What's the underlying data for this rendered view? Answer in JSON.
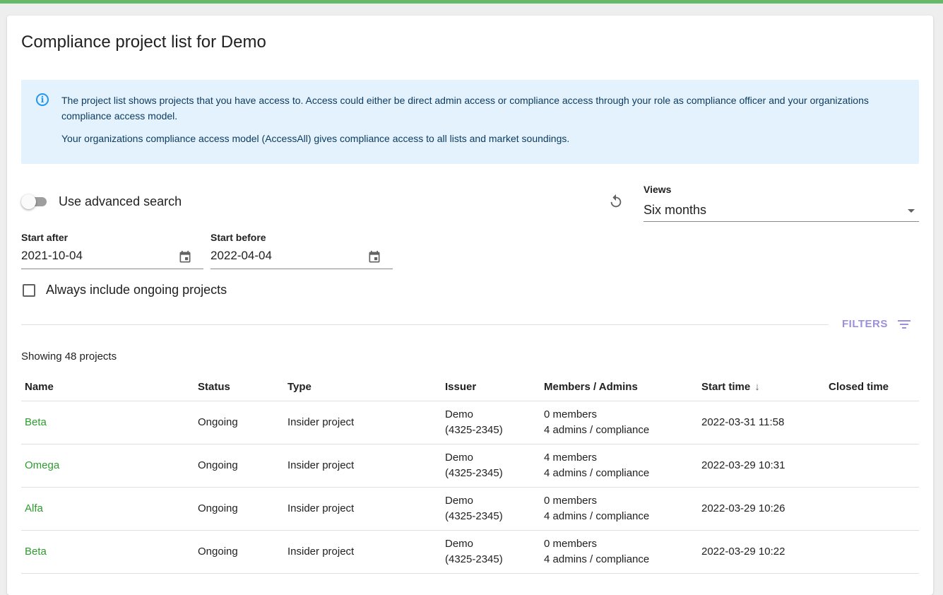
{
  "page": {
    "title": "Compliance project list for Demo"
  },
  "info": {
    "line1": "The project list shows projects that you have access to. Access could either be direct admin access or compliance access through your role as compliance officer and your organizations compliance access model.",
    "line2": "Your organizations compliance access model (AccessAll) gives compliance access to all lists and market soundings."
  },
  "search": {
    "advanced_label": "Use advanced search",
    "advanced_enabled": false
  },
  "views": {
    "label": "Views",
    "selected": "Six months"
  },
  "dates": {
    "start_after_label": "Start after",
    "start_after_value": "2021-10-04",
    "start_before_label": "Start before",
    "start_before_value": "2022-04-04"
  },
  "ongoing": {
    "label": "Always include ongoing projects",
    "checked": false
  },
  "filters": {
    "label": "FILTERS"
  },
  "list": {
    "count_text": "Showing 48 projects",
    "columns": [
      "Name",
      "Status",
      "Type",
      "Issuer",
      "Members / Admins",
      "Start time",
      "Closed time"
    ],
    "sort_arrow": "↓",
    "rows": [
      {
        "name": "Beta",
        "status": "Ongoing",
        "type": "Insider project",
        "issuer_name": "Demo",
        "issuer_id": "(4325-2345)",
        "members": "0 members",
        "admins": "4 admins / compliance",
        "start": "2022-03-31 11:58",
        "closed": ""
      },
      {
        "name": "Omega",
        "status": "Ongoing",
        "type": "Insider project",
        "issuer_name": "Demo",
        "issuer_id": "(4325-2345)",
        "members": "4 members",
        "admins": "4 admins / compliance",
        "start": "2022-03-29 10:31",
        "closed": ""
      },
      {
        "name": "Alfa",
        "status": "Ongoing",
        "type": "Insider project",
        "issuer_name": "Demo",
        "issuer_id": "(4325-2345)",
        "members": "0 members",
        "admins": "4 admins / compliance",
        "start": "2022-03-29 10:26",
        "closed": ""
      },
      {
        "name": "Beta",
        "status": "Ongoing",
        "type": "Insider project",
        "issuer_name": "Demo",
        "issuer_id": "(4325-2345)",
        "members": "0 members",
        "admins": "4 admins / compliance",
        "start": "2022-03-29 10:22",
        "closed": ""
      }
    ]
  },
  "colors": {
    "accent_green": "#2e9b2e",
    "info_background": "#e3f2fd",
    "info_icon": "#2196f3",
    "filters": "#9a8fe0"
  }
}
